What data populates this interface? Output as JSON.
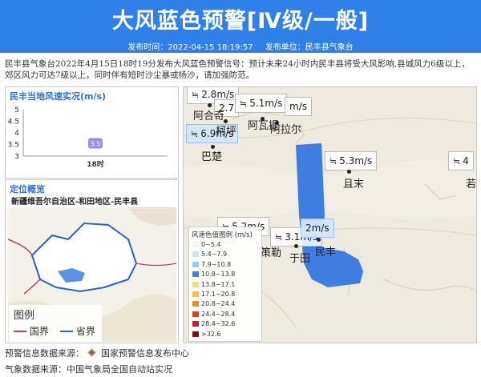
{
  "header": {
    "title": "大风蓝色预警[Ⅳ级/一般]",
    "publish_time": "发布时间：2022-04-15 18:19:57",
    "publish_unit": "发布单位：民丰县气象台"
  },
  "description": "民丰县气象台2022年4月15日18时19分发布大风蓝色预警信号：预计未来24小时内民丰县将受大风影响,县城风力6级以上，郊区风力可达7级以上，同时伴有短时沙尘暴或扬沙，请加强防范。",
  "wind_panel": {
    "title": "民丰当地风速实况(m/s)"
  },
  "chart_data": {
    "type": "scatter",
    "title": "民丰当地风速实况(m/s)",
    "categories": [
      "18时"
    ],
    "values": [
      3.5
    ],
    "data_labels": [
      "3.5"
    ],
    "y_ticks": [
      "5",
      "4.5",
      "4",
      "3.5",
      "3"
    ],
    "ylim": [
      3,
      5
    ],
    "grid": false
  },
  "location_panel": {
    "title": "定位概览",
    "region": "新疆维吾尔自治区-和田地区-民丰县",
    "legend_title": "图例",
    "legend_items": [
      {
        "label": "国界",
        "color": "#c0405a"
      },
      {
        "label": "省界",
        "color": "#2f5fd0"
      }
    ]
  },
  "map": {
    "legend_title": "风速色值图例 (m/s)",
    "legend_rows": [
      {
        "label": "0~5.4",
        "color": "#f4f4f4"
      },
      {
        "label": "5.4~7.9",
        "color": "#cfe3f7"
      },
      {
        "label": "7.9~10.8",
        "color": "#9dc6f0"
      },
      {
        "label": "10.8~13.8",
        "color": "#3f7ee0"
      },
      {
        "label": "13.8~17.1",
        "color": "#f7e07a"
      },
      {
        "label": "17.1~20.8",
        "color": "#f0c04a"
      },
      {
        "label": "20.8~24.4",
        "color": "#f08a30"
      },
      {
        "label": "24.4~28.4",
        "color": "#e03a20"
      },
      {
        "label": "28.4~32.6",
        "color": "#c02020"
      },
      {
        "label": ">32.6",
        "color": "#801010"
      }
    ],
    "wind_labels": [
      {
        "text": "2.8m/s"
      },
      {
        "text": "2.7"
      },
      {
        "text": "5.1m/s"
      },
      {
        "text": "m/s"
      },
      {
        "text": "6.9m/s"
      },
      {
        "text": "5.3m/s"
      },
      {
        "text": "4"
      },
      {
        "text": "5.2m/s"
      },
      {
        "text": "3.1m/s"
      },
      {
        "text": "2m/s"
      }
    ],
    "places": [
      {
        "name": "阿合奇"
      },
      {
        "name": "柯坪"
      },
      {
        "name": "阿瓦提"
      },
      {
        "name": "阿拉尔"
      },
      {
        "name": "巴楚"
      },
      {
        "name": "且末"
      },
      {
        "name": "若"
      },
      {
        "name": "策勒"
      },
      {
        "name": "于田"
      },
      {
        "name": "民丰"
      }
    ]
  },
  "footer": {
    "source1": "预警信息数据来源：",
    "source1_name": "国家预警信息发布中心",
    "source2": "气象数据来源：中国气象局全国自动站实况"
  },
  "colors": {
    "banner": "#2f80e8",
    "warning_zone": "#3f7ee0",
    "title_blue": "#2f6fd6"
  }
}
